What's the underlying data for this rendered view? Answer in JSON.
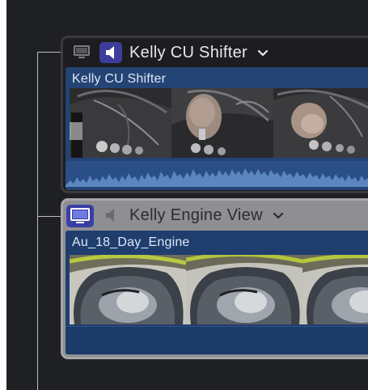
{
  "multicam": {
    "angles": [
      {
        "name": "Kelly CU Shifter",
        "video_monitor": "off",
        "audio_monitor": "on",
        "monitor_icon": "monitor-icon",
        "speaker_icon": "speaker-icon",
        "menu_icon": "chevron-down-icon",
        "clip": {
          "name": "Kelly CU Shifter",
          "content": "gear-shifter close-up filmstrip with audio waveform"
        }
      },
      {
        "name": "Kelly Engine View",
        "video_monitor": "on",
        "audio_monitor": "off",
        "monitor_icon": "monitor-icon",
        "speaker_icon": "speaker-icon",
        "menu_icon": "chevron-down-icon",
        "clip": {
          "name": "Au_18_Day_Engine",
          "content": "engine bay view filmstrip"
        }
      }
    ]
  },
  "colors": {
    "background": "#1f2023",
    "clip_blue": "#234474",
    "audio_active": "#3d3d9e",
    "video_active": "#3a3fa6",
    "selected_angle": "#8f8f93"
  }
}
